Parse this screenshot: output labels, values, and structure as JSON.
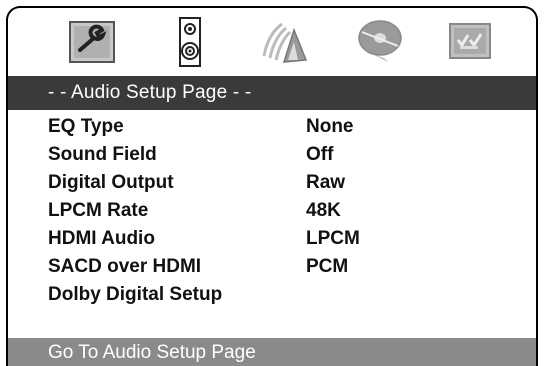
{
  "toolbar": {
    "icons": [
      {
        "name": "general-setup-icon"
      },
      {
        "name": "speaker-icon"
      },
      {
        "name": "video-setup-icon"
      },
      {
        "name": "disc-icon"
      },
      {
        "name": "preference-icon"
      }
    ]
  },
  "header": {
    "title": "- - Audio Setup Page - -"
  },
  "menu": {
    "items": [
      {
        "label": "EQ Type",
        "value": "None"
      },
      {
        "label": "Sound Field",
        "value": "Off"
      },
      {
        "label": "Digital Output",
        "value": "Raw"
      },
      {
        "label": "LPCM Rate",
        "value": "48K"
      },
      {
        "label": "HDMI Audio",
        "value": "LPCM"
      },
      {
        "label": "SACD over HDMI",
        "value": "PCM"
      },
      {
        "label": "Dolby Digital Setup",
        "value": ""
      }
    ]
  },
  "status": {
    "text": "Go To Audio Setup Page"
  },
  "colors": {
    "header_bg": "#3a3a3a",
    "status_bg": "#8a8a8a",
    "text": "#111111"
  }
}
